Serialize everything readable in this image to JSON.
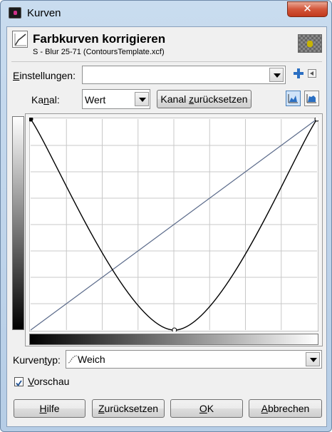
{
  "window": {
    "title": "Kurven",
    "close_glyph": "✕"
  },
  "header": {
    "title": "Farbkurven korrigieren",
    "subtitle": "S - Blur 25-71 (ContoursTemplate.xcf)",
    "icon": "curves-icon",
    "thumbnail": "image-thumbnail"
  },
  "presets": {
    "label_mnemonic": "E",
    "label_rest": "instellungen:",
    "value": "",
    "add_icon": "plus-icon",
    "menu_icon": "menu-arrow-icon"
  },
  "channel": {
    "label_pre": "Ka",
    "label_mnemonic": "n",
    "label_post": "al:",
    "value": "Wert",
    "reset_pre": "Kanal ",
    "reset_mnemonic": "z",
    "reset_post": "urücksetzen"
  },
  "histogram_toggles": [
    {
      "name": "linear-histogram-icon",
      "active": true
    },
    {
      "name": "log-histogram-icon",
      "active": false
    }
  ],
  "curve": {
    "control_points": [
      [
        0,
        255
      ],
      [
        128,
        0
      ],
      [
        255,
        255
      ]
    ],
    "grid_divisions": 8,
    "colors": {
      "curve": "#000000",
      "diagonal": "#5a6a8a",
      "grid": "#c8c8c8"
    }
  },
  "curve_type": {
    "label_pre": "Kurven",
    "label_mnemonic": "t",
    "label_post": "yp:",
    "value": "Weich",
    "icon": "smooth-curve-icon"
  },
  "preview": {
    "mnemonic": "V",
    "rest": "orschau",
    "checked": true
  },
  "buttons": {
    "help": {
      "mnemonic": "H",
      "rest": "ilfe"
    },
    "reset": {
      "mnemonic": "Z",
      "rest": "urücksetzen"
    },
    "ok": {
      "mnemonic": "O",
      "rest": "K"
    },
    "cancel": {
      "mnemonic": "A",
      "rest": "bbrechen"
    }
  }
}
